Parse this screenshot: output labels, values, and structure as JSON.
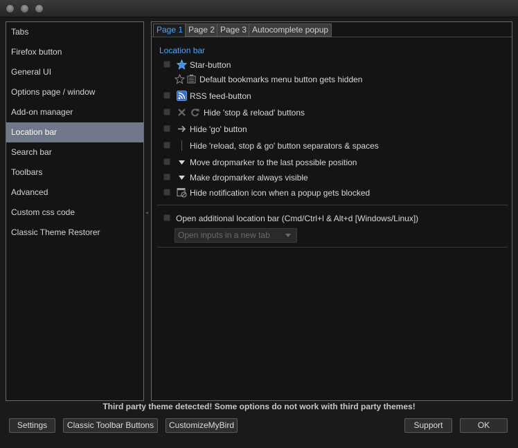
{
  "sidebar": {
    "items": [
      {
        "label": "Tabs"
      },
      {
        "label": "Firefox button"
      },
      {
        "label": "General UI"
      },
      {
        "label": "Options page / window"
      },
      {
        "label": "Add-on manager"
      },
      {
        "label": "Location bar",
        "selected": true
      },
      {
        "label": "Search bar"
      },
      {
        "label": "Toolbars"
      },
      {
        "label": "Advanced"
      },
      {
        "label": "Custom css code"
      },
      {
        "label": "Classic Theme Restorer"
      }
    ]
  },
  "tabs": [
    {
      "label": "Page 1",
      "active": true
    },
    {
      "label": "Page 2"
    },
    {
      "label": "Page 3"
    },
    {
      "label": "Autocomplete popup"
    }
  ],
  "section": {
    "title": "Location bar"
  },
  "options": {
    "star_button": {
      "label": "Star-button",
      "icon": "star-icon",
      "checked": false
    },
    "default_bookmarks": {
      "label": "Default bookmarks menu button gets hidden",
      "icon": "star-bookmarks-menu-icon"
    },
    "rss_feed": {
      "label": "RSS feed-button",
      "icon": "rss-icon",
      "checked": false
    },
    "hide_stop_reload": {
      "label": "Hide 'stop & reload' buttons",
      "icon": "stop-reload-icon",
      "checked": false
    },
    "hide_go": {
      "label": "Hide 'go' button",
      "icon": "arrow-right-icon",
      "checked": false
    },
    "hide_separators": {
      "label": "Hide 'reload, stop & go' button separators & spaces",
      "icon": "separator-icon",
      "checked": false
    },
    "move_dropmarker": {
      "label": "Move dropmarker to the last possible position",
      "icon": "triangle-down-icon",
      "checked": false
    },
    "dropmarker_visible": {
      "label": "Make dropmarker always visible",
      "icon": "triangle-down-icon",
      "checked": false
    },
    "hide_notification": {
      "label": "Hide notification icon when a popup gets blocked",
      "icon": "popup-blocked-icon",
      "checked": false
    },
    "additional_location": {
      "label": "Open additional location bar (Cmd/Ctrl+l & Alt+d [Windows/Linux])",
      "checked": false
    }
  },
  "dropdown": {
    "value": "Open inputs in a new tab"
  },
  "warning": "Third party theme detected! Some options do not work with third party themes!",
  "buttons": {
    "settings": "Settings",
    "classic_toolbar": "Classic Toolbar Buttons",
    "customize": "CustomizeMyBird",
    "support": "Support",
    "ok": "OK"
  },
  "colors": {
    "accent": "#4aa6ff",
    "selected_bg": "#6e7888",
    "window_bg": "#1a1a1a",
    "panel_bg": "#141414"
  }
}
